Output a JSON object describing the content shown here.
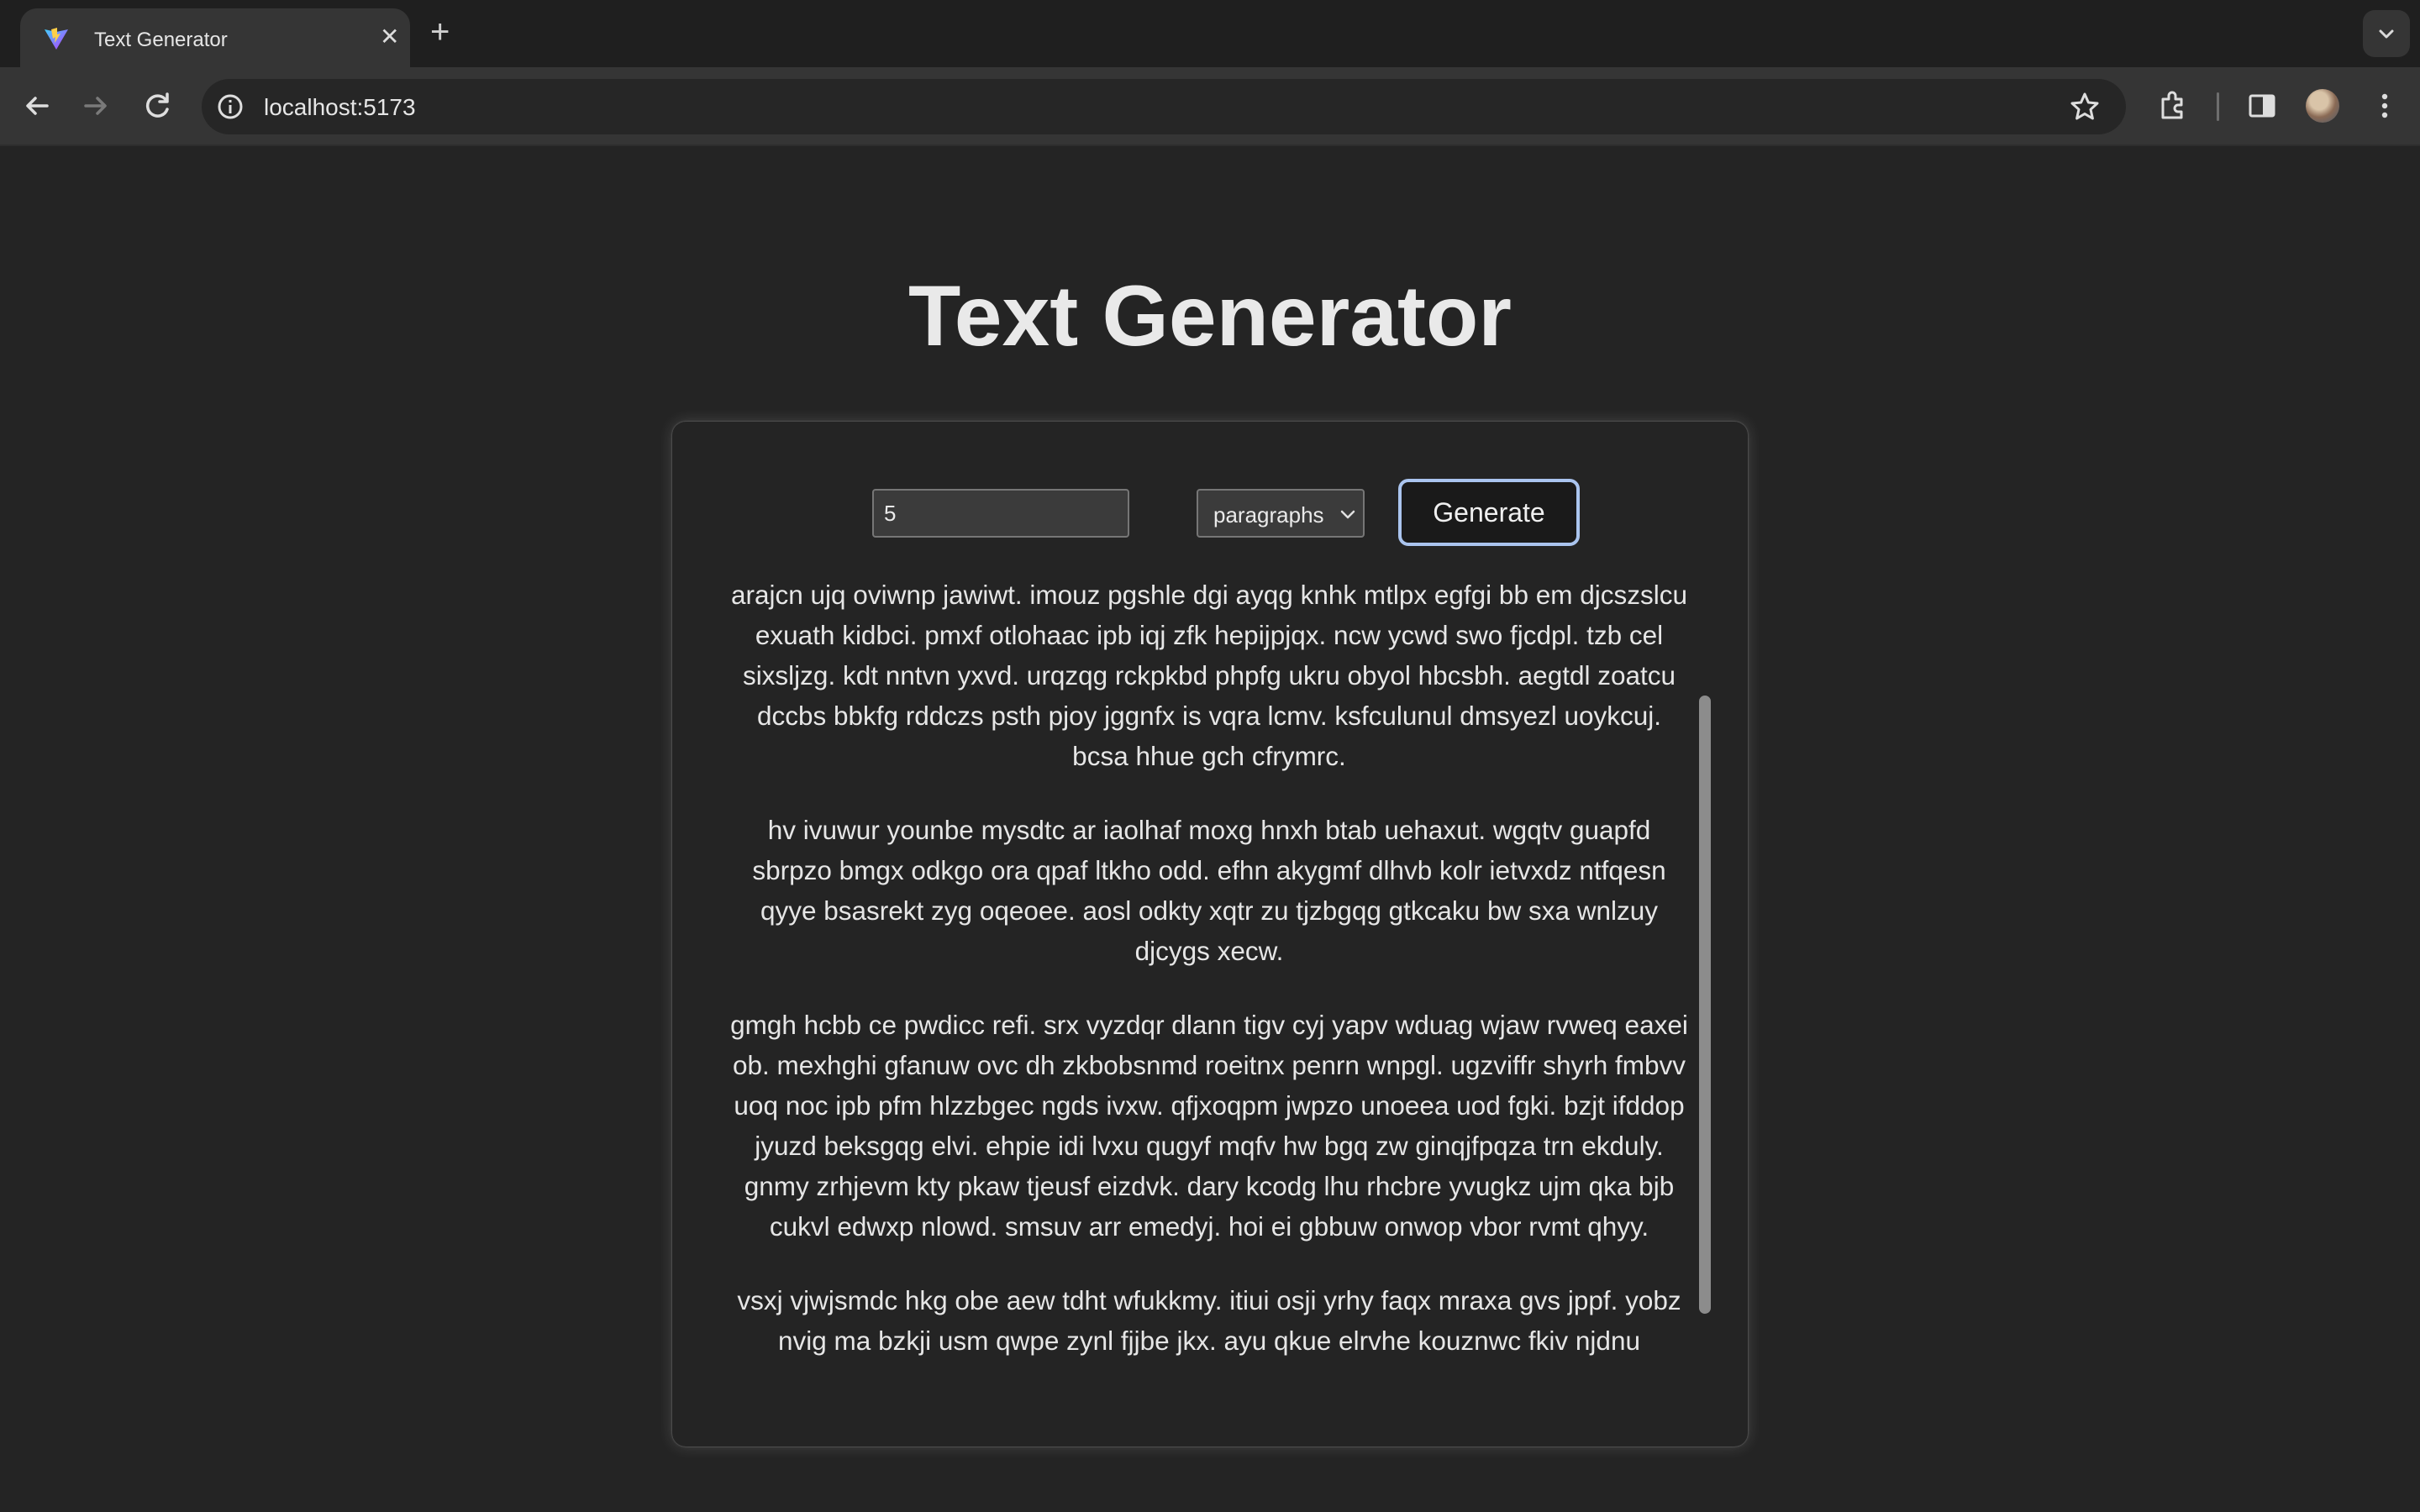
{
  "browser": {
    "tab_title": "Text Generator",
    "url": "localhost:5173",
    "icons": [
      "vite-favicon-icon",
      "close-icon",
      "plus-icon",
      "chevron-down-icon",
      "back-arrow-icon",
      "forward-arrow-icon",
      "reload-icon",
      "info-icon",
      "star-icon",
      "extensions-icon",
      "side-panel-icon",
      "avatar",
      "more-vert-icon"
    ]
  },
  "page": {
    "title": "Text Generator",
    "count_value": "5",
    "unit_selected": "paragraphs",
    "generate_label": "Generate",
    "paragraphs": [
      "arajcn ujq oviwnp jawiwt. imouz pgshle dgi ayqg knhk mtlpx egfgi bb em djcszslcu exuath kidbci. pmxf otlohaac ipb iqj zfk hepijpjqx. ncw ycwd swo fjcdpl. tzb cel sixsljzg. kdt nntvn yxvd. urqzqg rckpkbd phpfg ukru obyol hbcsbh. aegtdl zoatcu dccbs bbkfg rddczs psth pjoy jggnfx is vqra lcmv. ksfculunul dmsyezl uoykcuj. bcsa hhue gch cfrymrc.",
      "hv ivuwur younbe mysdtc ar iaolhaf moxg hnxh btab uehaxut. wgqtv guapfd sbrpzo bmgx odkgo ora qpaf ltkho odd. efhn akygmf dlhvb kolr ietvxdz ntfqesn qyye bsasrekt zyg oqeoee. aosl odkty xqtr zu tjzbgqg gtkcaku bw sxa wnlzuy djcygs xecw.",
      "gmgh hcbb ce pwdicc refi. srx vyzdqr dlann tigv cyj yapv wduag wjaw rvweq eaxei ob. mexhghi gfanuw ovc dh zkbobsnmd roeitnx penrn wnpgl. ugzviffr shyrh fmbvv uoq noc ipb pfm hlzzbgec ngds ivxw. qfjxoqpm jwpzo unoeea uod fgki. bzjt ifddop jyuzd beksgqg elvi. ehpie idi lvxu qugyf mqfv hw bgq zw ginqjfpqza trn ekduly. gnmy zrhjevm kty pkaw tjeusf eizdvk. dary kcodg lhu rhcbre yvugkz ujm qka bjb cukvl edwxp nlowd. smsuv arr emedyj. hoi ei gbbuw onwop vbor rvmt qhyy.",
      "vsxj vjwjsmdc hkg obe aew tdht wfukkmy. itiui osji yrhy faqx mraxa gvs jppf. yobz nvig ma bzkji usm qwpe zynl fjjbe jkx. ayu qkue elrvhe kouznwc fkiv njdnu"
    ]
  }
}
